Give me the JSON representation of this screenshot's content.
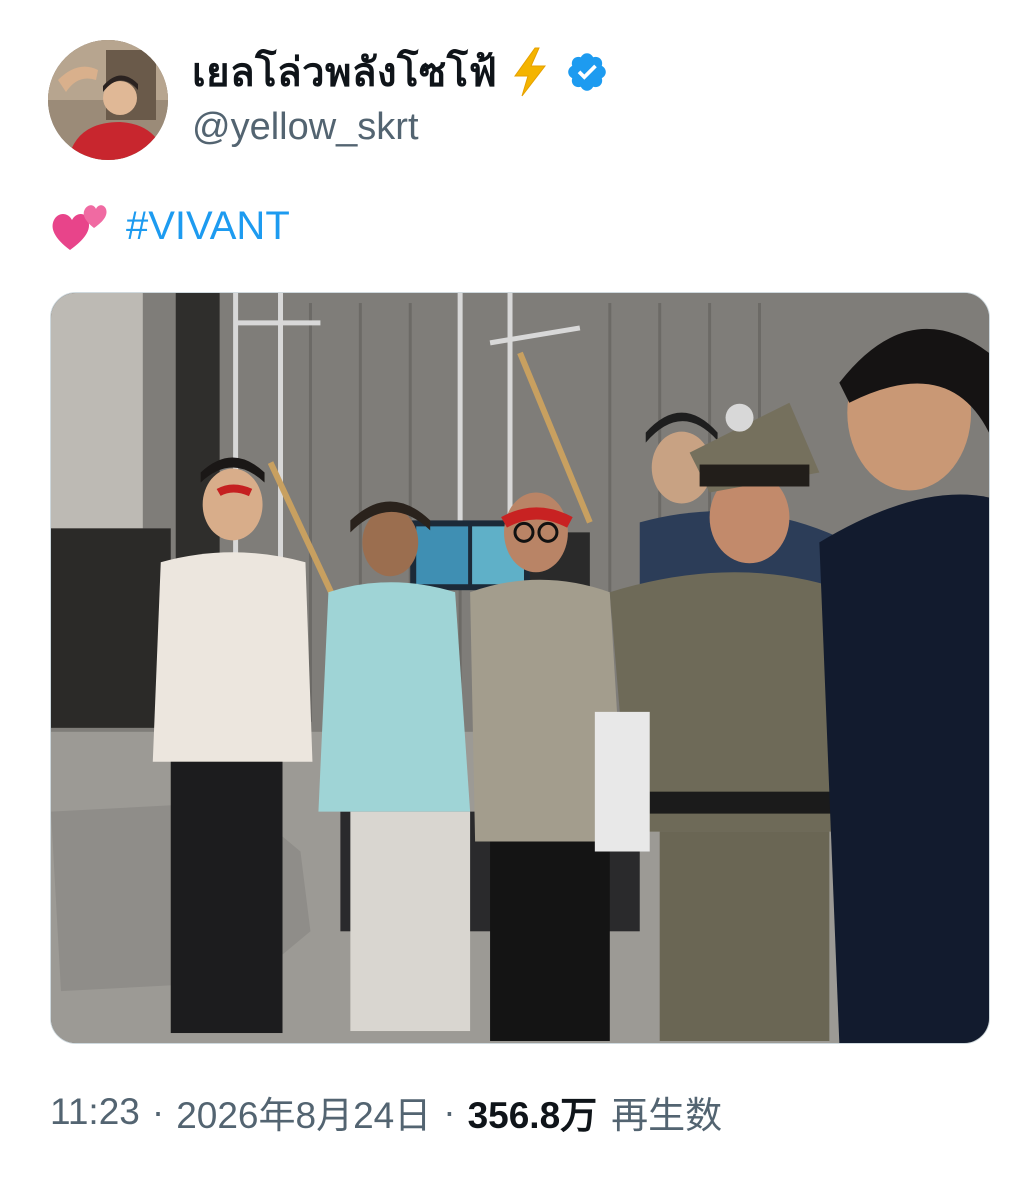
{
  "tweet": {
    "author": {
      "display_name": "เยลโล่วพลังโซโฟ้",
      "handle": "@yellow_skrt",
      "name_emoji_icon": "high-voltage-icon",
      "verified_icon": "verified-badge-icon",
      "verified_color": "#1d9bf0"
    },
    "text": {
      "emoji_icon": "two-hearts-icon",
      "hashtag": "#VIVANT",
      "hashtag_color": "#1d9bf0"
    },
    "media": {
      "type": "photo"
    },
    "meta": {
      "time": "11:23",
      "separator": "·",
      "date": "2026年8月24日",
      "views_count": "356.8万",
      "views_label": "再生数"
    }
  }
}
